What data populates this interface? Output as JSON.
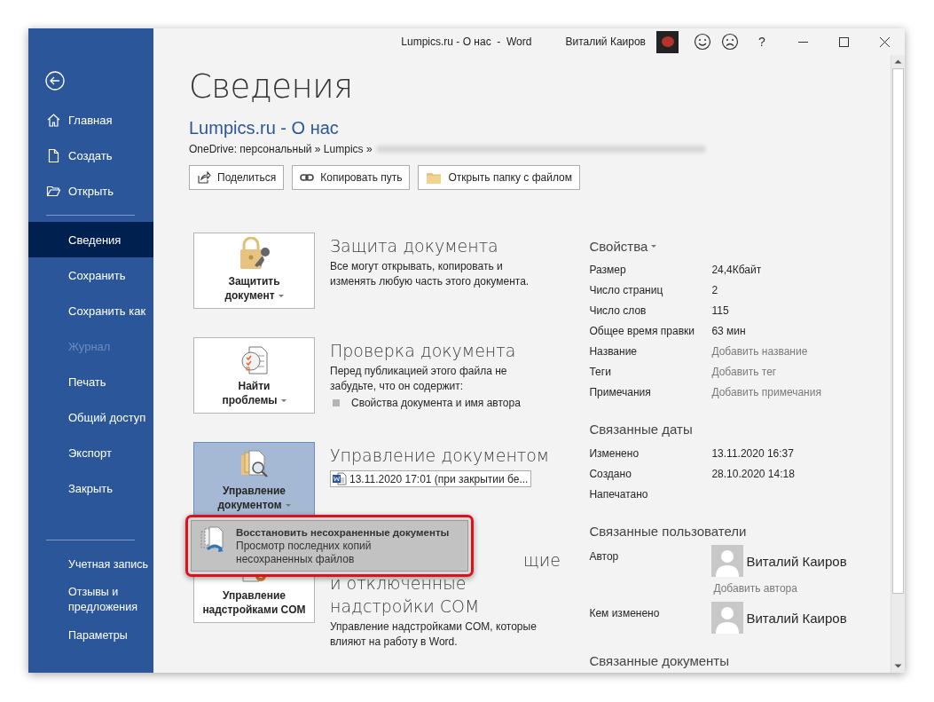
{
  "window": {
    "title": "Lumpics.ru - О нас  -  Word",
    "user": "Виталий Каиров",
    "help": "?"
  },
  "sidebar": {
    "top_items": [
      {
        "label": "Главная",
        "selected": false,
        "disabled": false
      },
      {
        "label": "Создать",
        "selected": false,
        "disabled": false
      },
      {
        "label": "Открыть",
        "selected": false,
        "disabled": false
      }
    ],
    "items": [
      {
        "label": "Сведения",
        "selected": true,
        "disabled": false
      },
      {
        "label": "Сохранить",
        "selected": false,
        "disabled": false
      },
      {
        "label": "Сохранить как",
        "selected": false,
        "disabled": false
      },
      {
        "label": "Журнал",
        "selected": false,
        "disabled": true
      },
      {
        "label": "Печать",
        "selected": false,
        "disabled": false
      },
      {
        "label": "Общий доступ",
        "selected": false,
        "disabled": false
      },
      {
        "label": "Экспорт",
        "selected": false,
        "disabled": false
      },
      {
        "label": "Закрыть",
        "selected": false,
        "disabled": false
      }
    ],
    "bottom_items": [
      {
        "label": "Учетная запись",
        "selected": false,
        "disabled": false
      },
      {
        "label": "Отзывы и предложения",
        "selected": false,
        "disabled": false
      },
      {
        "label": "Параметры",
        "selected": false,
        "disabled": false
      }
    ]
  },
  "page": {
    "heading": "Сведения",
    "doc_title": "Lumpics.ru - О нас",
    "path": "OneDrive: персональный » Lumpics »",
    "actions": [
      "Поделиться",
      "Копировать путь",
      "Открыть папку с файлом"
    ]
  },
  "sections": [
    {
      "button_lines": [
        "Защитить",
        "документ"
      ],
      "dropdown": true,
      "selected": false,
      "heading_lines": [
        "Защита документа"
      ],
      "description": "Все могут открывать, копировать и изменять любую часть этого документа."
    },
    {
      "button_lines": [
        "Найти",
        "проблемы"
      ],
      "dropdown": true,
      "selected": false,
      "heading_lines": [
        "Проверка документа"
      ],
      "description": "Перед публикацией этого файла не забудьте, что он содержит:",
      "bullets": [
        "Свойства документа и имя автора"
      ]
    },
    {
      "button_lines": [
        "Управление",
        "документом"
      ],
      "dropdown": true,
      "selected": true,
      "heading_lines": [
        "Управление документом"
      ],
      "versions": [
        "13.11.2020 17:01 (при закрытии бе..."
      ]
    },
    {
      "button_lines": [
        "Управление",
        "надстройками COM"
      ],
      "dropdown": false,
      "selected": false,
      "heading_lines": [
        "щие",
        "и отключенные",
        "надстройки COM"
      ],
      "description": "Управление надстройками COM, которые влияют на работу в Word."
    }
  ],
  "menu": {
    "title": "Восстановить несохраненные документы",
    "description": "Просмотр последних копий несохраненных файлов"
  },
  "properties": {
    "title": "Свойства",
    "rows": [
      {
        "label": "Размер",
        "value": "24,4Кбайт",
        "kind": "value"
      },
      {
        "label": "Число страниц",
        "value": "2",
        "kind": "value"
      },
      {
        "label": "Число слов",
        "value": "115",
        "kind": "value"
      },
      {
        "label": "Общее время правки",
        "value": "63 мин",
        "kind": "value"
      },
      {
        "label": "Название",
        "value": "Добавить название",
        "kind": "add"
      },
      {
        "label": "Теги",
        "value": "Добавить тег",
        "kind": "add"
      },
      {
        "label": "Примечания",
        "value": "Добавить примечания",
        "kind": "add"
      }
    ]
  },
  "dates": {
    "title": "Связанные даты",
    "rows": [
      {
        "label": "Изменено",
        "value": "13.11.2020 16:37"
      },
      {
        "label": "Создано",
        "value": "28.10.2020 14:18"
      },
      {
        "label": "Напечатано"
      }
    ]
  },
  "people": {
    "title": "Связанные пользователи",
    "rows": [
      {
        "label": "Автор",
        "name": "Виталий Каиров",
        "add": "Добавить автора"
      },
      {
        "label": "Кем изменено",
        "name": "Виталий Каиров"
      }
    ]
  },
  "related_docs": {
    "title": "Связанные документы"
  }
}
